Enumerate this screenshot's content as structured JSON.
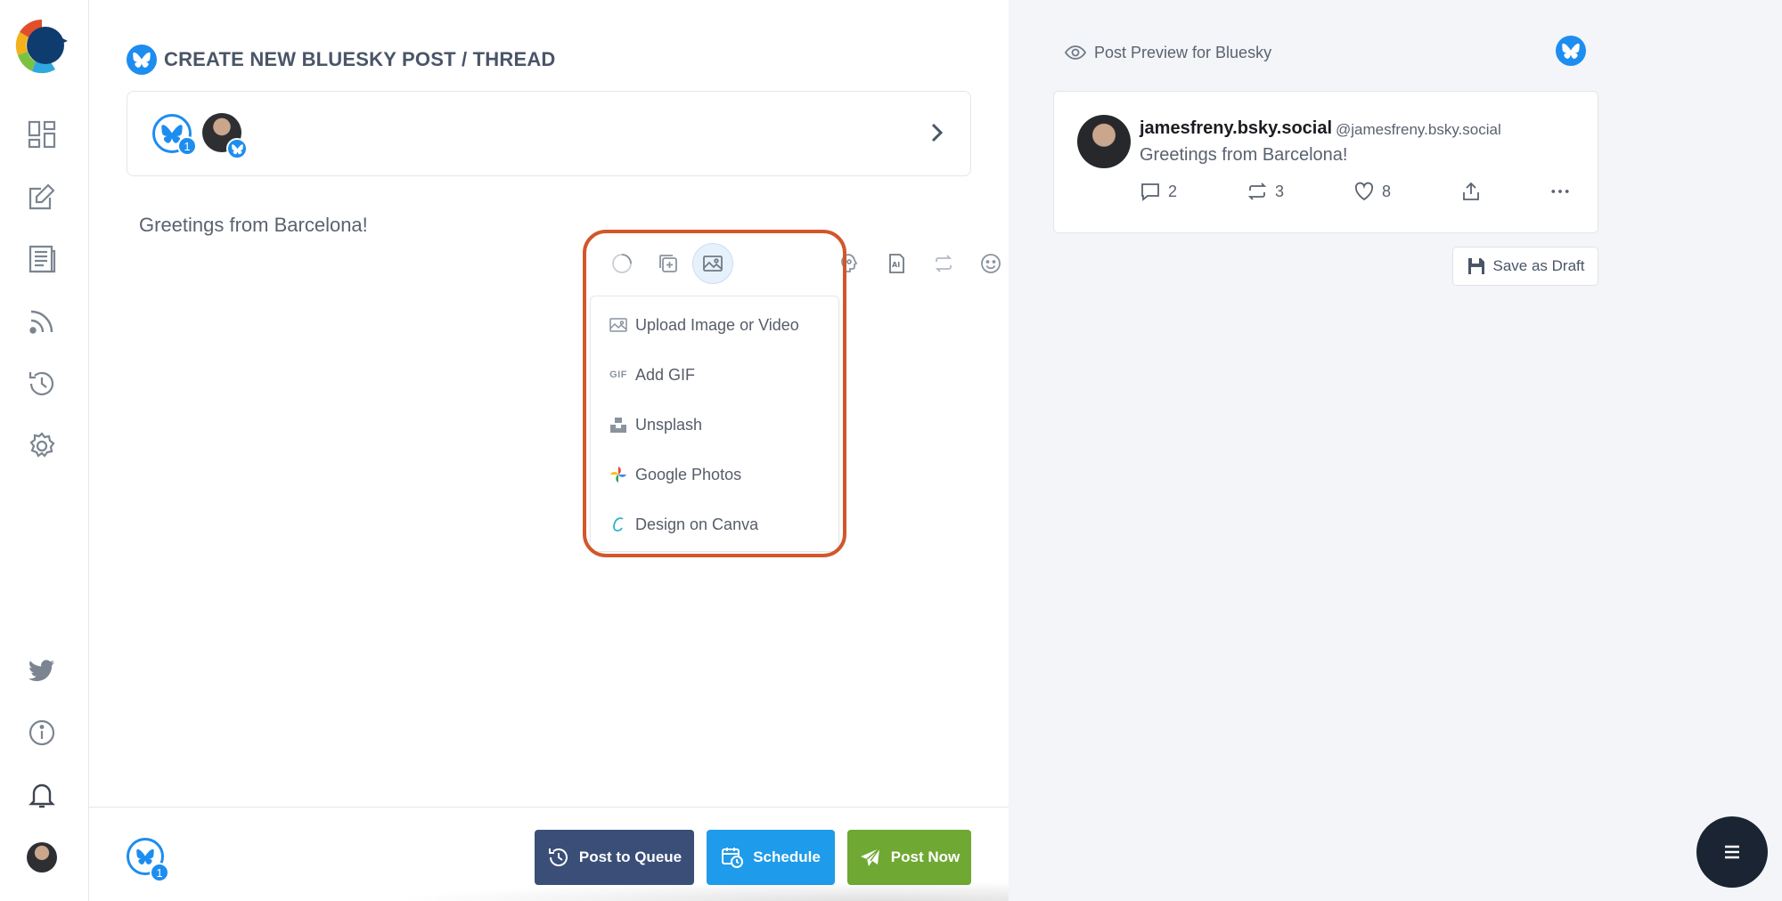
{
  "sidebar": {
    "nav_items": [
      "dashboard-icon",
      "compose-icon",
      "posts-icon",
      "rss-icon",
      "queue-icon",
      "settings-icon"
    ],
    "bottom_items": [
      "twitter-icon",
      "info-icon",
      "bell-icon",
      "avatar"
    ]
  },
  "editor": {
    "title": "CREATE NEW BLUESKY POST / THREAD",
    "account_count": "1",
    "post_text": "Greetings from Barcelona!",
    "media_menu": {
      "items": [
        {
          "label": "Upload Image or Video",
          "icon": "image-icon"
        },
        {
          "label": "Add GIF",
          "icon": "gif-icon"
        },
        {
          "label": "Unsplash",
          "icon": "unsplash-icon"
        },
        {
          "label": "Google Photos",
          "icon": "google-photos-icon"
        },
        {
          "label": "Design on Canva",
          "icon": "canva-icon"
        }
      ]
    },
    "gif_label": "GIF"
  },
  "footer": {
    "account_count": "1",
    "post_to_queue": "Post to Queue",
    "schedule": "Schedule",
    "post_now": "Post Now"
  },
  "preview": {
    "header": "Post Preview for Bluesky",
    "name": "jamesfreny.bsky.social",
    "handle": "@jamesfreny.bsky.social",
    "text": "Greetings from Barcelona!",
    "replies": "2",
    "reposts": "3",
    "likes": "8",
    "save_draft": "Save as Draft"
  },
  "colors": {
    "bluesky": "#1d8df0",
    "queue_button": "#3a4e78",
    "schedule_button": "#1e9bea",
    "post_now_button": "#6fa832",
    "highlight": "#d2562c"
  }
}
